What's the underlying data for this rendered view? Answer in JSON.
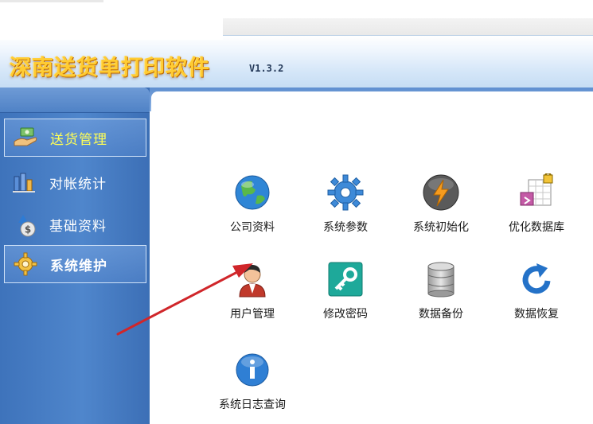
{
  "app": {
    "title": "深南送货单打印软件",
    "version": "V1.3.2"
  },
  "sidebar": {
    "items": [
      {
        "label": "送货管理",
        "icon": "hand-money-icon",
        "active": true
      },
      {
        "label": "对帐统计",
        "icon": "bar-chart-icon",
        "active": false
      },
      {
        "label": "基础资料",
        "icon": "money-bag-icon",
        "active": false
      },
      {
        "label": "系统维护",
        "icon": "gear-icon",
        "active": true
      }
    ]
  },
  "main": {
    "tiles": [
      {
        "label": "公司资料",
        "icon": "globe-icon"
      },
      {
        "label": "系统参数",
        "icon": "gear-icon"
      },
      {
        "label": "系统初始化",
        "icon": "lightning-icon"
      },
      {
        "label": "优化数据库",
        "icon": "database-lock-icon"
      },
      {
        "label": "用户管理",
        "icon": "user-icon"
      },
      {
        "label": "修改密码",
        "icon": "key-icon"
      },
      {
        "label": "数据备份",
        "icon": "database-icon"
      },
      {
        "label": "数据恢复",
        "icon": "refresh-icon"
      },
      {
        "label": "系统日志查询",
        "icon": "info-icon"
      }
    ]
  },
  "colors": {
    "sidebar": "#4f86cc",
    "title_text": "#ffcc33",
    "annotation_arrow": "#d0262a"
  }
}
